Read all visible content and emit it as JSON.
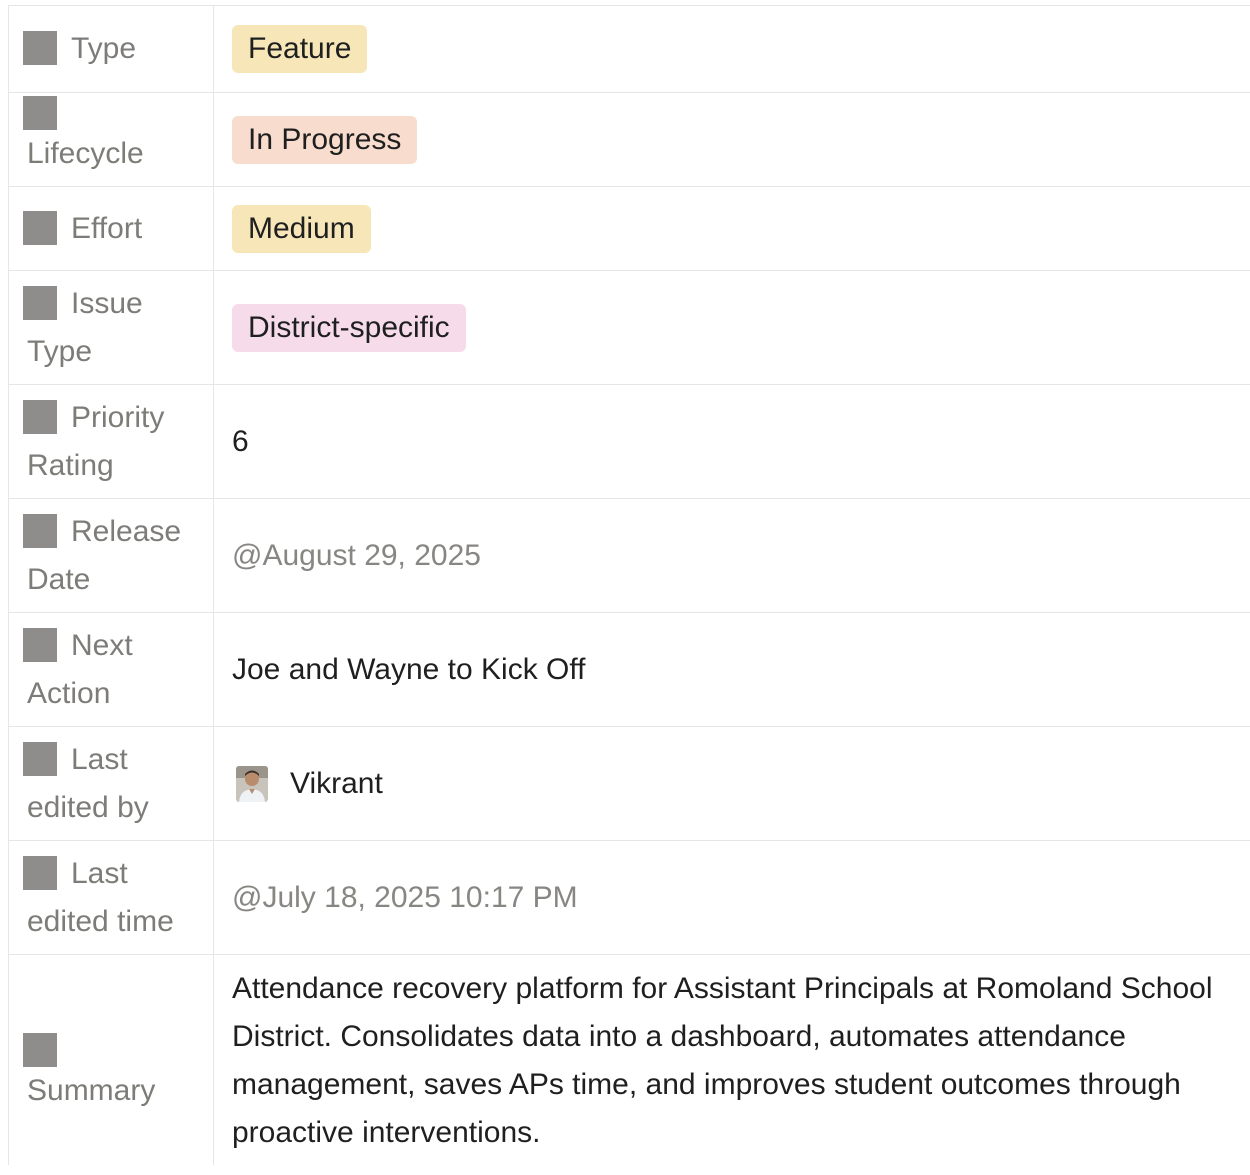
{
  "properties": [
    {
      "label_first": "Type",
      "label_rest": "",
      "value": "Feature",
      "kind": "pill",
      "color": "#f6e6b8"
    },
    {
      "label_first": "",
      "label_rest": "Lifecycle",
      "value": "In Progress",
      "kind": "pill",
      "color": "#f8dccd"
    },
    {
      "label_first": "Effort",
      "label_rest": "",
      "value": "Medium",
      "kind": "pill",
      "color": "#f6e6b8"
    },
    {
      "label_first": "Issue",
      "label_rest": "Type",
      "value": "District-specific",
      "kind": "pill",
      "color": "#f6dcea"
    },
    {
      "label_first": "Priority",
      "label_rest": "Rating",
      "value": "6",
      "kind": "text"
    },
    {
      "label_first": "Release",
      "label_rest": "Date",
      "value": "@August 29, 2025",
      "kind": "date"
    },
    {
      "label_first": "Next",
      "label_rest": "Action",
      "value": "Joe and Wayne to Kick Off",
      "kind": "text"
    },
    {
      "label_first": "Last",
      "label_rest": "edited by",
      "value": "Vikrant",
      "kind": "person"
    },
    {
      "label_first": "Last",
      "label_rest": "edited time",
      "value": "@July 18, 2025 10:17 PM",
      "kind": "date"
    },
    {
      "label_first": "",
      "label_rest": "Summary",
      "value": "Attendance recovery platform for Assistant Principals at Romoland School District. Consolidates data into a dashboard, automates attendance management, saves APs time, and improves student outcomes through proactive interventions.",
      "kind": "longtext"
    }
  ],
  "colors": {
    "border": "#e6e6e3",
    "label_text": "#7d7c78",
    "property_icon": "#8e8d8b",
    "muted_value": "#878682"
  },
  "icons": {
    "property": "property-type-icon",
    "person": "user-avatar-icon"
  }
}
